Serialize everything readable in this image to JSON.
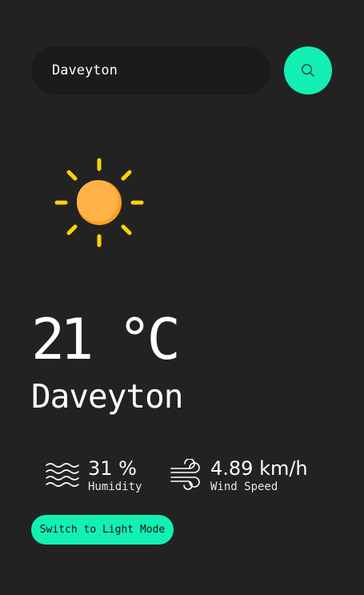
{
  "search": {
    "value": "Daveyton",
    "icon": "search-icon"
  },
  "weather": {
    "icon": "sun-icon",
    "temperature": "21 °C",
    "city": "Daveyton"
  },
  "stats": {
    "humidity_value": "31 %",
    "humidity_label": "Humidity",
    "humidity_icon": "humidity-waves-icon",
    "wind_value": "4.89 km/h",
    "wind_label": "Wind Speed",
    "wind_icon": "wind-icon"
  },
  "mode_toggle": {
    "label": "Switch to Light Mode"
  },
  "colors": {
    "background": "#222222",
    "accent": "#13f0b4",
    "sun_body": "#ffb347",
    "sun_rays": "#ffd400"
  }
}
